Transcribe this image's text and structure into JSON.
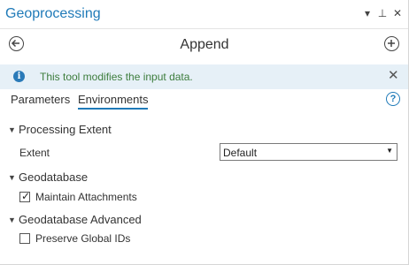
{
  "pane": {
    "title": "Geoprocessing",
    "controls": {
      "dropdown_icon": "▾",
      "pin_icon": "⊥",
      "close_icon": "✕"
    }
  },
  "tool": {
    "name": "Append",
    "back_icon": "back-circle-arrow",
    "add_icon": "add-circle-plus"
  },
  "info": {
    "icon": "i",
    "message": "This tool modifies the input data.",
    "close": "✕"
  },
  "tabs": [
    {
      "label": "Parameters",
      "active": false
    },
    {
      "label": "Environments",
      "active": true
    }
  ],
  "help": {
    "icon": "?"
  },
  "groups": [
    {
      "title": "Processing Extent",
      "chevron": "⌄",
      "params": [
        {
          "label": "Extent",
          "type": "dropdown",
          "value": "Default",
          "arrow": "▼"
        }
      ]
    },
    {
      "title": "Geodatabase",
      "chevron": "⌄",
      "params": [
        {
          "label": "Maintain Attachments",
          "type": "checkbox",
          "checked": true,
          "mark": "✓"
        }
      ]
    },
    {
      "title": "Geodatabase Advanced",
      "chevron": "⌄",
      "params": [
        {
          "label": "Preserve Global IDs",
          "type": "checkbox",
          "checked": false
        }
      ]
    }
  ],
  "colors": {
    "title": "#1f7ab8",
    "info_bar": "#e6f0f7",
    "info_text": "#3d7d3d",
    "accent": "#1f7ab8"
  }
}
